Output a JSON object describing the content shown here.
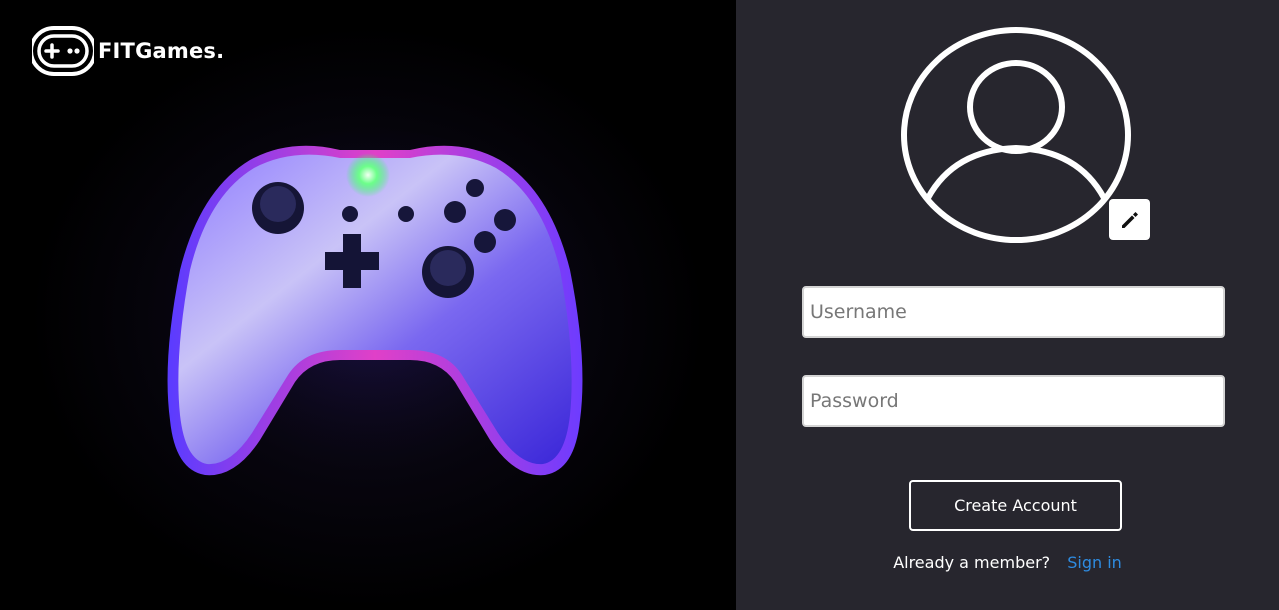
{
  "brand": {
    "name": "FITGames.",
    "logo_icon": "gamepad-logo-icon"
  },
  "hero": {
    "image": "neon-game-controller",
    "colors": {
      "neon_blue": "#4a37ff",
      "neon_pink": "#e040c8",
      "center_light": "#6dff8a"
    }
  },
  "profile": {
    "avatar_icon": "user-avatar-icon",
    "edit_icon": "pencil-icon"
  },
  "form": {
    "username_placeholder": "Username",
    "username_value": "",
    "password_placeholder": "Password",
    "password_value": "",
    "submit_label": "Create Account",
    "member_prompt": "Already a member?",
    "signin_label": "Sign in"
  },
  "colors": {
    "panel_bg": "#27262e",
    "link": "#2e8be0",
    "left_bg": "#000000"
  }
}
